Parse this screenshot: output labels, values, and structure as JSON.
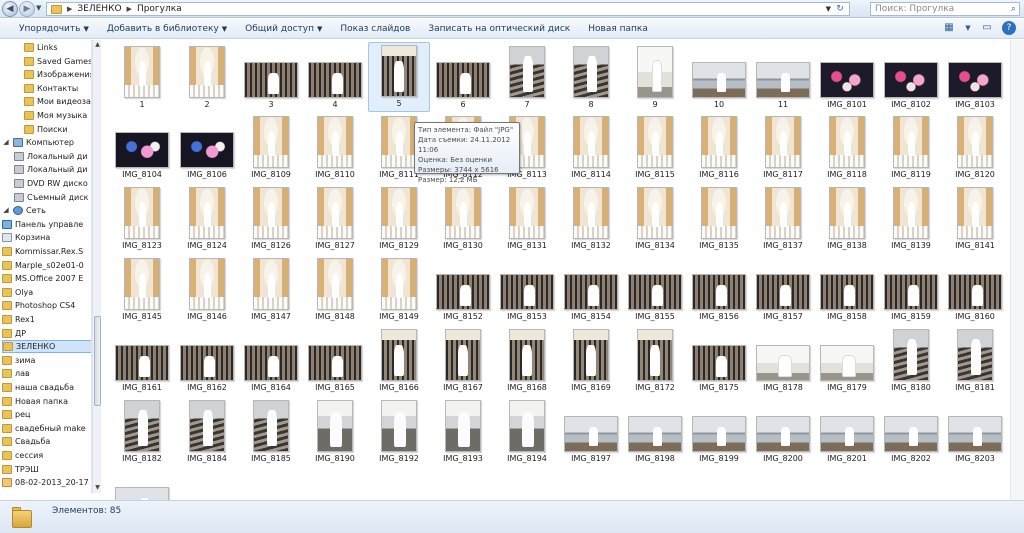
{
  "address": {
    "path": [
      "ЗЕЛЕНКО",
      "Прогулка"
    ],
    "search_placeholder": "Поиск: Прогулка"
  },
  "toolbar": {
    "organize": "Упорядочить",
    "add_to_library": "Добавить в библиотеку",
    "share": "Общий доступ",
    "slideshow": "Показ слайдов",
    "burn": "Записать на оптический диск",
    "new_folder": "Новая папка"
  },
  "sidebar": [
    {
      "label": "Links",
      "icon": "folder-icon",
      "level": 2
    },
    {
      "label": "Saved Games",
      "icon": "folder-icon",
      "level": 2
    },
    {
      "label": "Изображения",
      "icon": "folder-icon",
      "level": 2
    },
    {
      "label": "Контакты",
      "icon": "folder-icon",
      "level": 2
    },
    {
      "label": "Мои видеозап",
      "icon": "folder-icon",
      "level": 2
    },
    {
      "label": "Моя музыка",
      "icon": "folder-icon",
      "level": 2
    },
    {
      "label": "Поиски",
      "icon": "folder-icon",
      "level": 2
    },
    {
      "label": "Компьютер",
      "icon": "computer-icon",
      "level": 0
    },
    {
      "label": "Локальный ди",
      "icon": "drive-icon",
      "level": 1
    },
    {
      "label": "Локальный ди",
      "icon": "drive-icon",
      "level": 1
    },
    {
      "label": "DVD RW диско",
      "icon": "drive-icon",
      "level": 1
    },
    {
      "label": "Съемный диск",
      "icon": "drive-icon",
      "level": 1
    },
    {
      "label": "Сеть",
      "icon": "network-icon",
      "level": 0
    },
    {
      "label": "Панель управле",
      "icon": "control-panel-icon",
      "level": 0
    },
    {
      "label": "Корзина",
      "icon": "recycle-bin-icon",
      "level": 0
    },
    {
      "label": "Kommissar.Rex.S",
      "icon": "folder-icon",
      "level": 0
    },
    {
      "label": "Marple_s02e01-0",
      "icon": "folder-icon",
      "level": 0
    },
    {
      "label": "MS.Office 2007 E",
      "icon": "folder-icon",
      "level": 0
    },
    {
      "label": "Olya",
      "icon": "folder-icon",
      "level": 0
    },
    {
      "label": "Photoshop CS4",
      "icon": "folder-icon",
      "level": 0
    },
    {
      "label": "Rex1",
      "icon": "folder-icon",
      "level": 0
    },
    {
      "label": "ДР",
      "icon": "folder-icon",
      "level": 0
    },
    {
      "label": "ЗЕЛЕНКО",
      "icon": "folder-icon",
      "level": 0,
      "selected": true
    },
    {
      "label": "зима",
      "icon": "folder-icon",
      "level": 0
    },
    {
      "label": "лав",
      "icon": "folder-icon",
      "level": 0
    },
    {
      "label": "наша свадьба",
      "icon": "folder-icon",
      "level": 0
    },
    {
      "label": "Новая папка",
      "icon": "folder-icon",
      "level": 0
    },
    {
      "label": "рец",
      "icon": "folder-icon",
      "level": 0
    },
    {
      "label": "свадебный make",
      "icon": "folder-icon",
      "level": 0
    },
    {
      "label": "Свадьба",
      "icon": "folder-icon",
      "level": 0
    },
    {
      "label": "сессия",
      "icon": "folder-icon",
      "level": 0
    },
    {
      "label": "ТРЭШ",
      "icon": "folder-icon",
      "level": 0
    },
    {
      "label": "08-02-2013_20-17",
      "icon": "file-icon",
      "level": 0
    }
  ],
  "files": [
    {
      "name": "1",
      "kind": "arch",
      "o": "p"
    },
    {
      "name": "2",
      "kind": "arch",
      "o": "p"
    },
    {
      "name": "3",
      "kind": "gate",
      "o": "l"
    },
    {
      "name": "4",
      "kind": "gate",
      "o": "l"
    },
    {
      "name": "5",
      "kind": "gate-v",
      "o": "p"
    },
    {
      "name": "6",
      "kind": "gate",
      "o": "l"
    },
    {
      "name": "7",
      "kind": "stair",
      "o": "p"
    },
    {
      "name": "8",
      "kind": "stair",
      "o": "p"
    },
    {
      "name": "9",
      "kind": "white",
      "o": "p"
    },
    {
      "name": "10",
      "kind": "lake",
      "o": "l"
    },
    {
      "name": "11",
      "kind": "lake",
      "o": "l"
    },
    {
      "name": "IMG_8101",
      "kind": "night",
      "o": "l"
    },
    {
      "name": "IMG_8102",
      "kind": "night",
      "o": "l"
    },
    {
      "name": "IMG_8103",
      "kind": "night",
      "o": "l"
    },
    {
      "name": "IMG_8104",
      "kind": "night2",
      "o": "l"
    },
    {
      "name": "IMG_8106",
      "kind": "night2",
      "o": "l"
    },
    {
      "name": "IMG_8109",
      "kind": "arch",
      "o": "p"
    },
    {
      "name": "IMG_8110",
      "kind": "arch",
      "o": "p"
    },
    {
      "name": "IMG_8111",
      "kind": "arch",
      "o": "p"
    },
    {
      "name": "IMG_8112",
      "kind": "arch",
      "o": "p"
    },
    {
      "name": "IMG_8113",
      "kind": "arch",
      "o": "p"
    },
    {
      "name": "IMG_8114",
      "kind": "arch",
      "o": "p"
    },
    {
      "name": "IMG_8115",
      "kind": "arch",
      "o": "p"
    },
    {
      "name": "IMG_8116",
      "kind": "arch",
      "o": "p"
    },
    {
      "name": "IMG_8117",
      "kind": "arch",
      "o": "p"
    },
    {
      "name": "IMG_8118",
      "kind": "arch",
      "o": "p"
    },
    {
      "name": "IMG_8119",
      "kind": "arch",
      "o": "p"
    },
    {
      "name": "IMG_8120",
      "kind": "arch",
      "o": "p"
    },
    {
      "name": "IMG_8123",
      "kind": "arch",
      "o": "p"
    },
    {
      "name": "IMG_8124",
      "kind": "arch",
      "o": "p"
    },
    {
      "name": "IMG_8126",
      "kind": "arch",
      "o": "p"
    },
    {
      "name": "IMG_8127",
      "kind": "arch",
      "o": "p"
    },
    {
      "name": "IMG_8129",
      "kind": "arch",
      "o": "p"
    },
    {
      "name": "IMG_8130",
      "kind": "arch",
      "o": "p"
    },
    {
      "name": "IMG_8131",
      "kind": "arch",
      "o": "p"
    },
    {
      "name": "IMG_8132",
      "kind": "arch",
      "o": "p"
    },
    {
      "name": "IMG_8134",
      "kind": "arch",
      "o": "p"
    },
    {
      "name": "IMG_8135",
      "kind": "arch",
      "o": "p"
    },
    {
      "name": "IMG_8137",
      "kind": "arch",
      "o": "p"
    },
    {
      "name": "IMG_8138",
      "kind": "arch",
      "o": "p"
    },
    {
      "name": "IMG_8139",
      "kind": "arch",
      "o": "p"
    },
    {
      "name": "IMG_8141",
      "kind": "arch",
      "o": "p"
    },
    {
      "name": "IMG_8145",
      "kind": "arch",
      "o": "p"
    },
    {
      "name": "IMG_8146",
      "kind": "arch",
      "o": "p"
    },
    {
      "name": "IMG_8147",
      "kind": "arch",
      "o": "p"
    },
    {
      "name": "IMG_8148",
      "kind": "arch",
      "o": "p"
    },
    {
      "name": "IMG_8149",
      "kind": "arch",
      "o": "p"
    },
    {
      "name": "IMG_8152",
      "kind": "gate",
      "o": "l"
    },
    {
      "name": "IMG_8153",
      "kind": "gate",
      "o": "l"
    },
    {
      "name": "IMG_8154",
      "kind": "gate",
      "o": "l"
    },
    {
      "name": "IMG_8155",
      "kind": "gate",
      "o": "l"
    },
    {
      "name": "IMG_8156",
      "kind": "gate",
      "o": "l"
    },
    {
      "name": "IMG_8157",
      "kind": "gate",
      "o": "l"
    },
    {
      "name": "IMG_8158",
      "kind": "gate",
      "o": "l"
    },
    {
      "name": "IMG_8159",
      "kind": "gate",
      "o": "l"
    },
    {
      "name": "IMG_8160",
      "kind": "gate",
      "o": "l"
    },
    {
      "name": "IMG_8161",
      "kind": "gate",
      "o": "l"
    },
    {
      "name": "IMG_8162",
      "kind": "gate",
      "o": "l"
    },
    {
      "name": "IMG_8164",
      "kind": "gate",
      "o": "l"
    },
    {
      "name": "IMG_8165",
      "kind": "gate",
      "o": "l"
    },
    {
      "name": "IMG_8166",
      "kind": "gate-v",
      "o": "p"
    },
    {
      "name": "IMG_8167",
      "kind": "gate-v",
      "o": "p"
    },
    {
      "name": "IMG_8168",
      "kind": "gate-v",
      "o": "p"
    },
    {
      "name": "IMG_8169",
      "kind": "gate-v",
      "o": "p"
    },
    {
      "name": "IMG_8172",
      "kind": "gate-v",
      "o": "p"
    },
    {
      "name": "IMG_8175",
      "kind": "gate",
      "o": "l"
    },
    {
      "name": "IMG_8178",
      "kind": "white",
      "o": "l"
    },
    {
      "name": "IMG_8179",
      "kind": "white",
      "o": "l"
    },
    {
      "name": "IMG_8180",
      "kind": "stair",
      "o": "p"
    },
    {
      "name": "IMG_8181",
      "kind": "stair",
      "o": "p"
    },
    {
      "name": "IMG_8182",
      "kind": "stair",
      "o": "p"
    },
    {
      "name": "IMG_8184",
      "kind": "stair",
      "o": "p"
    },
    {
      "name": "IMG_8185",
      "kind": "stair",
      "o": "p"
    },
    {
      "name": "IMG_8190",
      "kind": "trees",
      "o": "p"
    },
    {
      "name": "IMG_8192",
      "kind": "trees",
      "o": "p"
    },
    {
      "name": "IMG_8193",
      "kind": "trees",
      "o": "p"
    },
    {
      "name": "IMG_8194",
      "kind": "trees",
      "o": "p"
    },
    {
      "name": "IMG_8197",
      "kind": "lake",
      "o": "l"
    },
    {
      "name": "IMG_8198",
      "kind": "lake",
      "o": "l"
    },
    {
      "name": "IMG_8199",
      "kind": "lake",
      "o": "l"
    },
    {
      "name": "IMG_8200",
      "kind": "lake",
      "o": "l"
    },
    {
      "name": "IMG_8201",
      "kind": "lake",
      "o": "l"
    },
    {
      "name": "IMG_8202",
      "kind": "lake",
      "o": "l"
    },
    {
      "name": "IMG_8203",
      "kind": "lake",
      "o": "l"
    },
    {
      "name": "",
      "kind": "lake",
      "o": "l"
    }
  ],
  "selected_file": "5",
  "tooltip": {
    "type": "Тип элемента: Файл \"JPG\"",
    "date": "Дата съемки: 24.11.2012 11:06",
    "rating": "Оценка: Без оценки",
    "dimensions": "Размеры: 3744 x 5616",
    "size": "Размер: 12,2 МБ"
  },
  "status": {
    "count": "Элементов: 85"
  },
  "colors": {
    "selection": "#cfe3fa",
    "toolbar_text": "#1e395b"
  }
}
